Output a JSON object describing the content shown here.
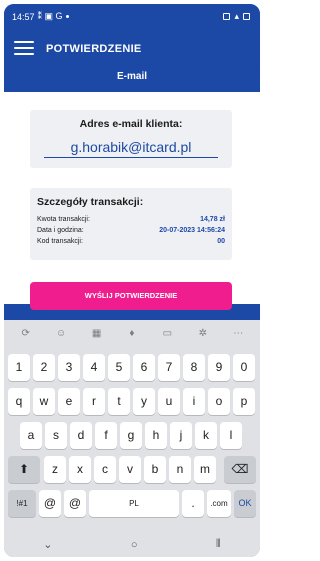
{
  "status_bar": {
    "time": "14:57",
    "left_glyphs": "⁑ ▣ G"
  },
  "app": {
    "title": "POTWIERDZENIE",
    "subtitle": "E-mail"
  },
  "email": {
    "label": "Adres e-mail klienta:",
    "value": "g.horabik@itcard.pl"
  },
  "transaction": {
    "title": "Szczegóły transakcji:",
    "rows": [
      {
        "label": "Kwota transakcji:",
        "value": "14,78 zł"
      },
      {
        "label": "Data i godzina:",
        "value": "20-07-2023 14:56:24"
      },
      {
        "label": "Kod transakcji:",
        "value": "00"
      }
    ]
  },
  "send_button": {
    "label": "WYŚLIJ POTWIERDZENIE"
  },
  "keyboard": {
    "row_numbers": [
      "1",
      "2",
      "3",
      "4",
      "5",
      "6",
      "7",
      "8",
      "9",
      "0"
    ],
    "row1": [
      "q",
      "w",
      "e",
      "r",
      "t",
      "y",
      "u",
      "i",
      "o",
      "p"
    ],
    "row2": [
      "a",
      "s",
      "d",
      "f",
      "g",
      "h",
      "j",
      "k",
      "l"
    ],
    "row3": [
      "z",
      "x",
      "c",
      "v",
      "b",
      "n",
      "m"
    ],
    "symbols_key": "!#1",
    "at_key": "@",
    "at_key2": "@",
    "space_label": "PL",
    "dot_key": ".",
    "com_key": ".com",
    "ok_key": "OK"
  },
  "colors": {
    "brand_blue": "#1d49a6",
    "accent_pink": "#f01d8f"
  }
}
